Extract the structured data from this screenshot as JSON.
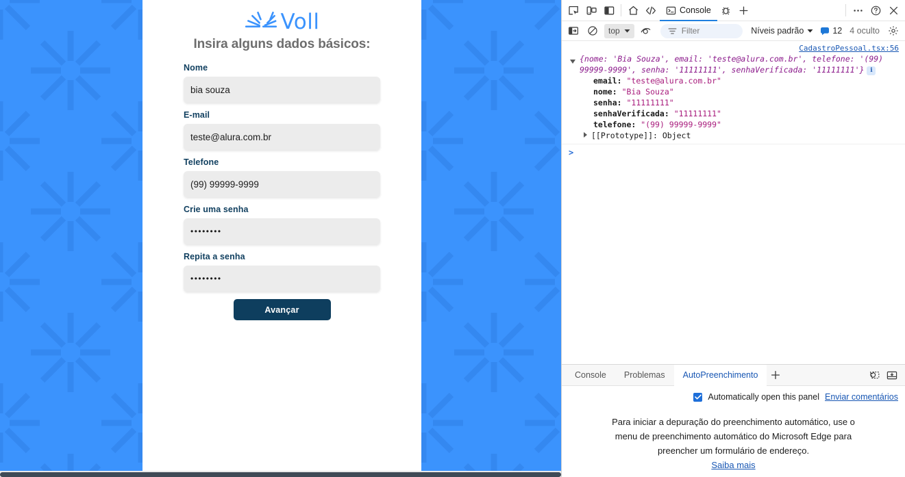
{
  "page": {
    "brand": {
      "name": "Voll",
      "mark": "voll-sunburst-logo",
      "color": "#3b93fd"
    },
    "subtitle": "Insira alguns dados básicos:",
    "fields": [
      {
        "label": "Nome",
        "value": "bia souza",
        "type": "text",
        "name": "nome"
      },
      {
        "label": "E-mail",
        "value": "teste@alura.com.br",
        "type": "text",
        "name": "email"
      },
      {
        "label": "Telefone",
        "value": "(99) 99999-9999",
        "type": "text",
        "name": "telefone"
      },
      {
        "label": "Crie uma senha",
        "value": "••••••••",
        "type": "password",
        "name": "senha"
      },
      {
        "label": "Repita a senha",
        "value": "••••••••",
        "type": "password",
        "name": "senha-verificada"
      }
    ],
    "submit_label": "Avançar",
    "background_color": "#3b93fd",
    "label_color": "#103f5f",
    "button_color": "#0e3e5e"
  },
  "devtools": {
    "toolbar": {
      "inspect_label": "Inspecionar",
      "device_label": "Alternar emulação de dispositivo",
      "dock_label": "Ancorar painel",
      "home_label": "Bem-vindo",
      "elements_label": "Elementos",
      "active_tab": "Console",
      "issues_label": "Problemas",
      "more_tools_label": "Mais ferramentas",
      "more_label": "Personalizar e controlar o DevTools",
      "help_label": "Ajuda",
      "close_label": "Fechar DevTools"
    },
    "filterbar": {
      "sidebar_label": "Mostrar barra lateral do console",
      "clear_label": "Limpar console",
      "context": "top",
      "eye_label": "Criar ao vivo",
      "filter_placeholder": "Filter",
      "levels": "Níveis padrão",
      "message_count": "12",
      "hidden_count": "4 oculto",
      "settings_label": "Configurações do console"
    },
    "console": {
      "source": "CadastroPessoal.tsx:56",
      "preview": "{nome: 'Bia Souza', email: 'teste@alura.com.br', telefone: '(99) 99999-9999', senha: '11111111', senhaVerificada: '11111111'}",
      "info_badge": "i",
      "properties": [
        {
          "key": "email:",
          "value": "\"teste@alura.com.br\""
        },
        {
          "key": "nome:",
          "value": "\"Bia Souza\""
        },
        {
          "key": "senha:",
          "value": "\"11111111\""
        },
        {
          "key": "senhaVerificada:",
          "value": "\"11111111\""
        },
        {
          "key": "telefone:",
          "value": "\"(99) 99999-9999\""
        }
      ],
      "prototype": "[[Prototype]]: Object",
      "prompt": ">"
    },
    "drawer": {
      "tabs": [
        {
          "label": "Console",
          "active": false
        },
        {
          "label": "Problemas",
          "active": false
        },
        {
          "label": "AutoPreenchimento",
          "active": true
        }
      ],
      "add_tab_label": "Mais ferramentas",
      "restore_label": "Restaurar gaveta",
      "dock_bottom_label": "Ancorar na parte inferior",
      "auto_open_label": "Automatically open this panel",
      "auto_open_checked": true,
      "feedback_label": "Enviar comentários",
      "message": "Para iniciar a depuração do preenchimento automático, use o menu de preenchimento automático do Microsoft Edge para preencher um formulário de endereço.",
      "learn_more": "Saiba mais"
    }
  }
}
